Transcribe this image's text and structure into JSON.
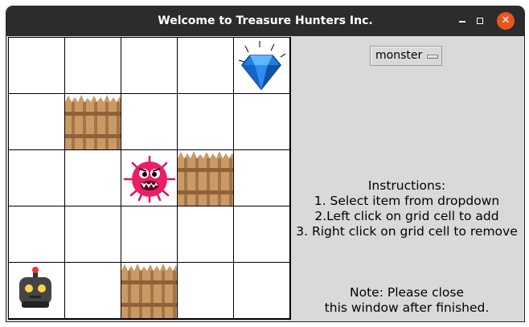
{
  "window": {
    "title": "Welcome to Treasure Hunters Inc."
  },
  "grid": {
    "rows": 5,
    "cols": 5,
    "items": [
      {
        "row": 0,
        "col": 4,
        "type": "diamond",
        "icon": "diamond-icon"
      },
      {
        "row": 1,
        "col": 1,
        "type": "fence",
        "icon": "fence-icon"
      },
      {
        "row": 2,
        "col": 2,
        "type": "monster",
        "icon": "monster-icon"
      },
      {
        "row": 2,
        "col": 3,
        "type": "fence",
        "icon": "fence-icon"
      },
      {
        "row": 4,
        "col": 0,
        "type": "robot",
        "icon": "robot-icon"
      },
      {
        "row": 4,
        "col": 2,
        "type": "fence",
        "icon": "fence-icon"
      }
    ]
  },
  "dropdown": {
    "selected": "monster"
  },
  "instructions": {
    "title": "Instructions:",
    "lines": [
      "1. Select item from dropdown",
      "2.Left click on grid cell to add",
      "3. Right click on grid cell to remove"
    ]
  },
  "note": {
    "lines": [
      "Note: Please close",
      "this window after finished."
    ]
  },
  "colors": {
    "titlebar": "#2c2c2c",
    "close_button": "#e95420",
    "panel": "#d9d9d9"
  }
}
